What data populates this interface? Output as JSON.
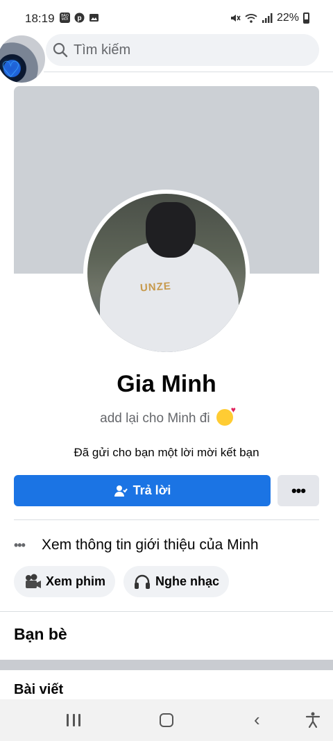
{
  "status_bar": {
    "time": "18:19",
    "left_icons": [
      "bao-moi-icon",
      "pinterest-icon",
      "gallery-icon"
    ],
    "badge_text": "BÁO MỚI",
    "battery": "22%"
  },
  "search": {
    "placeholder": "Tìm kiếm"
  },
  "profile": {
    "name": "Gia Minh",
    "bio": "add lại cho Minh đi",
    "shirt_text": "UNZE",
    "friend_request_text": "Đã gửi cho bạn một lời mời kết bạn",
    "reply_label": "Trả lời",
    "more_label": "•••"
  },
  "intro": {
    "dots": "•••",
    "label": "Xem thông tin giới thiệu của Minh"
  },
  "hobbies": [
    {
      "label": "Xem phim",
      "icon": "movie-camera-icon"
    },
    {
      "label": "Nghe nhạc",
      "icon": "headphones-icon"
    }
  ],
  "sections": {
    "friends": "Bạn bè",
    "posts": "Bài viết"
  },
  "colors": {
    "primary": "#1b74e4",
    "cover": "#ccd0d5",
    "chip_bg": "#f0f2f5"
  }
}
